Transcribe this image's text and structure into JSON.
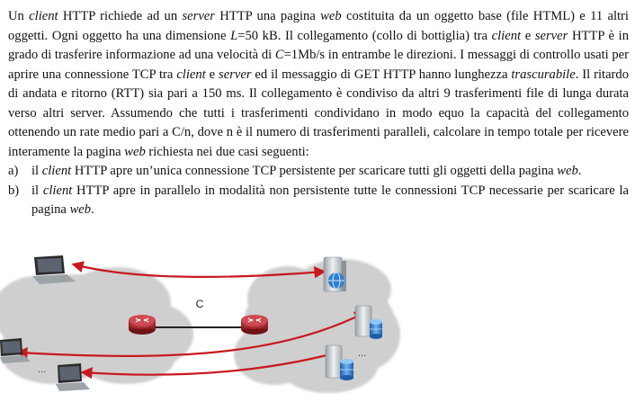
{
  "document": {
    "paragraph": [
      {
        "t": "Un ",
        "i": false
      },
      {
        "t": "client",
        "i": true
      },
      {
        "t": " HTTP richiede ad un ",
        "i": false
      },
      {
        "t": "server",
        "i": true
      },
      {
        "t": " HTTP una pagina ",
        "i": false
      },
      {
        "t": "web",
        "i": true
      },
      {
        "t": " costituita da un oggetto base (file HTML) e 11 altri oggetti. Ogni oggetto ha una dimensione ",
        "i": false
      },
      {
        "t": "L",
        "i": true
      },
      {
        "t": "=50 kB. Il collegamento (collo di bottiglia) tra ",
        "i": false
      },
      {
        "t": "client",
        "i": true
      },
      {
        "t": " e ",
        "i": false
      },
      {
        "t": "server",
        "i": true
      },
      {
        "t": " HTTP è in grado di trasferire informazione ad una velocità di ",
        "i": false
      },
      {
        "t": "C",
        "i": true
      },
      {
        "t": "=1Mb/s in entrambe le direzioni. I messaggi di controllo usati per aprire una connessione TCP tra ",
        "i": false
      },
      {
        "t": "client",
        "i": true
      },
      {
        "t": " e ",
        "i": false
      },
      {
        "t": "server",
        "i": true
      },
      {
        "t": " ed il messaggio di GET HTTP hanno lunghezza ",
        "i": false
      },
      {
        "t": "trascurabile",
        "i": true
      },
      {
        "t": ". Il ritardo di andata e ritorno (RTT) sia pari a 150 ms. Il collegamento è condiviso da altri 9 trasferimenti file di lunga durata verso altri server. Assumendo che tutti i trasferimenti condividano in modo equo la capacità del collegamento ottenendo un rate medio pari a C/n, dove n è il numero di trasferimenti paralleli, calcolare in tempo totale per ricevere interamente la pagina ",
        "i": false
      },
      {
        "t": "web",
        "i": true
      },
      {
        "t": " richiesta nei due casi seguenti:",
        "i": false
      }
    ],
    "items": [
      {
        "label": "a)",
        "runs": [
          {
            "t": "il ",
            "i": false
          },
          {
            "t": "client",
            "i": true
          },
          {
            "t": " HTTP apre un’unica connessione TCP persistente per scaricare tutti gli oggetti della pagina ",
            "i": false
          },
          {
            "t": "web",
            "i": true
          },
          {
            "t": ".",
            "i": false
          }
        ]
      },
      {
        "label": "b)",
        "runs": [
          {
            "t": "il ",
            "i": false
          },
          {
            "t": "client",
            "i": true
          },
          {
            "t": " HTTP apre in parallelo in modalità non persistente tutte le connessioni TCP necessarie per scaricare la pagina ",
            "i": false
          },
          {
            "t": "web",
            "i": true
          },
          {
            "t": ".",
            "i": false
          }
        ]
      }
    ]
  },
  "diagram": {
    "link_label": "C",
    "ellipsis": "...",
    "colors": {
      "cloud": "#cfcfcf",
      "arrow": "#c8191e",
      "router": "#b3262c",
      "server": "#d8dadc",
      "database": "#2f7fd0",
      "laptop": "#2b2b2b"
    },
    "icons": [
      "laptop-icon",
      "router-icon",
      "web-server-icon",
      "database-server-icon"
    ]
  }
}
